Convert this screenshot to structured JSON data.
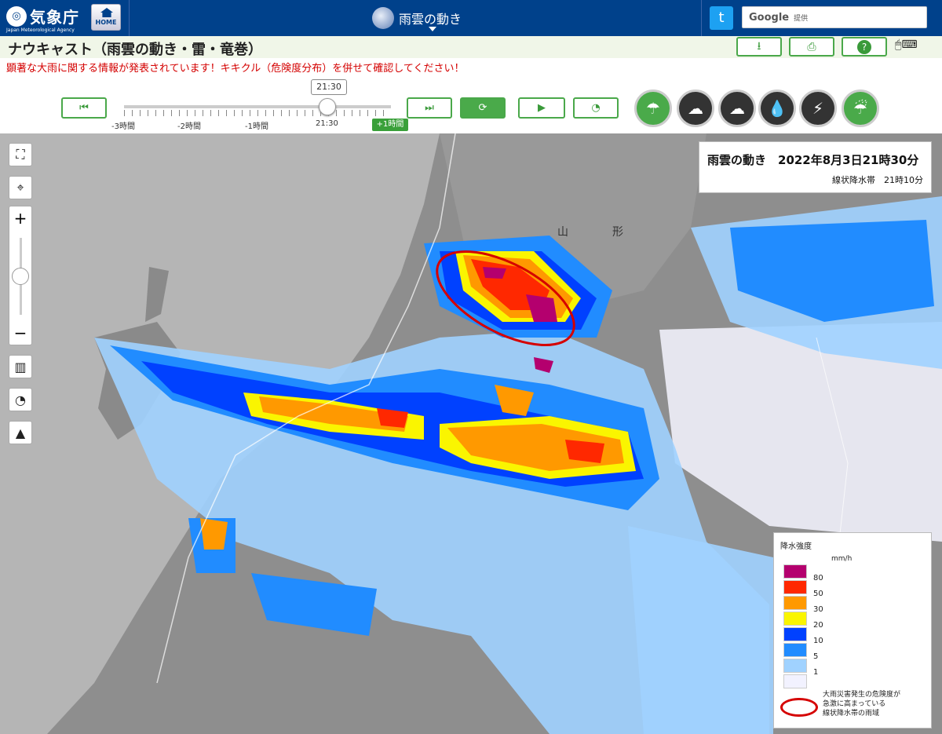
{
  "header": {
    "agency_name": "気象庁",
    "agency_name_en": "Japan Meteorological Agency",
    "home_label": "HOME",
    "mode_label": "雨雲の動き",
    "search_brand": "Google",
    "search_suffix": "提供"
  },
  "page": {
    "title": "ナウキャスト（雨雲の動き・雷・竜巻）",
    "notice": "顕著な大雨に関する情報が発表されています！キキクル（危険度分布）を併せて確認してください！"
  },
  "timeline": {
    "current_time": "21:30",
    "labels": [
      "-3時間",
      "-2時間",
      "-1時間",
      "21:30"
    ],
    "plus_label": "+1時間",
    "position_fraction": 0.75
  },
  "icons": {
    "download": "download-icon",
    "print": "print-icon",
    "help": "help-icon",
    "mouse": "mouse-icon",
    "keyboard": "keyboard-icon",
    "twitter": "twitter-icon"
  },
  "map": {
    "info_title": "雨雲の動き　2022年8月3日21時30分",
    "info_sub": "線状降水帯　21時10分",
    "place_names": [
      "山",
      "形"
    ]
  },
  "legend": {
    "title": "降水強度",
    "unit": "mm/h",
    "levels": [
      {
        "value": "80",
        "color": "#b4006e"
      },
      {
        "value": "50",
        "color": "#ff2800"
      },
      {
        "value": "30",
        "color": "#ff9900"
      },
      {
        "value": "20",
        "color": "#faf500"
      },
      {
        "value": "10",
        "color": "#0041ff"
      },
      {
        "value": "5",
        "color": "#218cff"
      },
      {
        "value": "1",
        "color": "#a0d2ff"
      },
      {
        "value": "",
        "color": "#f2f2ff"
      }
    ],
    "ring_text": "大雨災害発生の危険度が\n急激に高まっている\n線状降水帯の雨域"
  },
  "colors": {
    "brand": "#00418b",
    "accent": "#4aa84a",
    "notice": "#d40000"
  }
}
